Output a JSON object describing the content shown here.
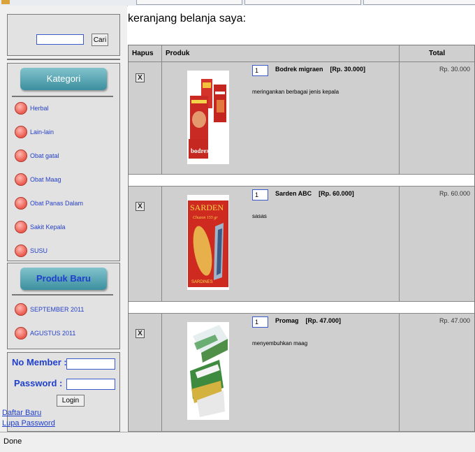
{
  "sidebar": {
    "search_button": "Cari",
    "kategori_title": "Kategori",
    "categories": [
      "Herbal",
      "Lain-lain",
      "Obat gatal",
      "Obat Maag",
      "Obat Panas Dalam",
      "Sakit Kepala",
      "SUSU"
    ],
    "produk_baru_title": "Produk Baru",
    "produk_baru_items": [
      "SEPTEMBER 2011",
      "AGUSTUS 2011"
    ],
    "login": {
      "member_label": "No Member :",
      "password_label": "Password :",
      "login_button": "Login",
      "register_link": "Daftar Baru",
      "forgot_link": "Lupa Password"
    }
  },
  "cart": {
    "title": "keranjang belanja saya:",
    "columns": {
      "remove": "Hapus",
      "product": "Produk",
      "total": "Total"
    },
    "items": [
      {
        "qty": "1",
        "name": "Bodrek migraen    [Rp. 30.000]",
        "description": "meringankan berbagai jenis kepala",
        "total": "Rp. 30.000",
        "image_icon": "bodrex-product-image",
        "remove_mark": "X"
      },
      {
        "qty": "1",
        "name": "Sarden ABC    [Rp. 60.000]",
        "description": "sasas",
        "total": "Rp. 60.000",
        "image_icon": "sarden-can-image",
        "remove_mark": "X"
      },
      {
        "qty": "1",
        "name": "Promag    [Rp. 47.000]",
        "description": "menyembuhkan maag",
        "total": "Rp. 47.000",
        "image_icon": "promag-pack-image",
        "remove_mark": "X"
      }
    ]
  },
  "status": {
    "text": "Done"
  },
  "colors": {
    "accent_header": "#3c8f9f",
    "link": "#1f3fcc",
    "panel_bg": "#e2e2e2",
    "bullet": "#ea5a4e"
  }
}
